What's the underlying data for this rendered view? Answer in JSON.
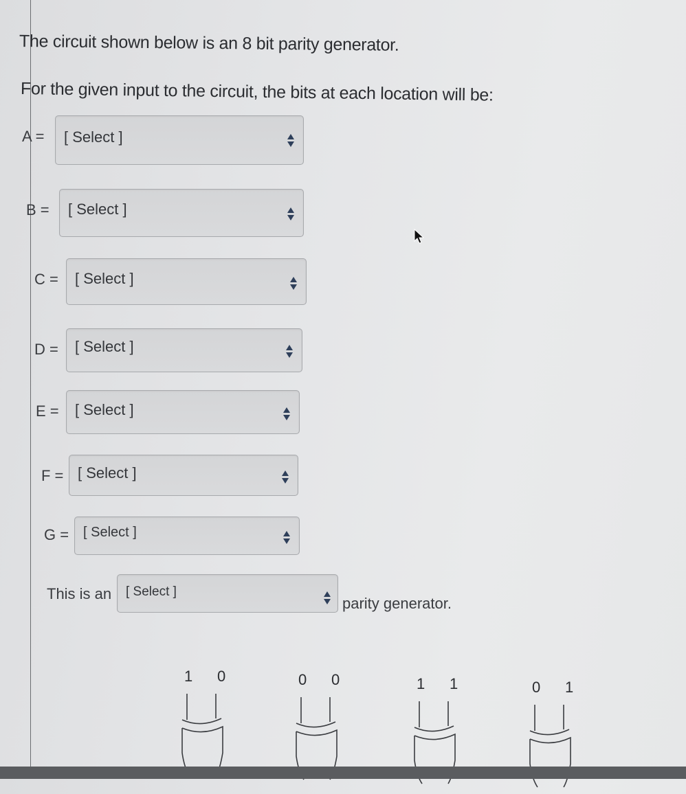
{
  "question": {
    "line1": "The circuit shown below is an 8 bit parity generator.",
    "line2": "For the given input to the circuit, the bits at each location will be:"
  },
  "dropdowns": [
    {
      "label": "A =",
      "value": "[ Select ]"
    },
    {
      "label": "B =",
      "value": "[ Select ]"
    },
    {
      "label": "C =",
      "value": "[ Select ]"
    },
    {
      "label": "D =",
      "value": "[ Select ]"
    },
    {
      "label": "E =",
      "value": "[ Select ]"
    },
    {
      "label": "F =",
      "value": "[ Select ]"
    },
    {
      "label": "G =",
      "value": "[ Select ]"
    }
  ],
  "parity_type": {
    "prefix": "This is an",
    "value": "[ Select ]",
    "suffix": "parity generator."
  },
  "circuit": {
    "gate_type": "XOR",
    "gates": [
      {
        "inputs": [
          "1",
          "0"
        ]
      },
      {
        "inputs": [
          "0",
          "0"
        ]
      },
      {
        "inputs": [
          "1",
          "1"
        ]
      },
      {
        "inputs": [
          "0",
          "1"
        ]
      }
    ]
  },
  "icons": {
    "select_arrows": "up-down-caret-icon",
    "cursor": "mouse-pointer-icon"
  }
}
